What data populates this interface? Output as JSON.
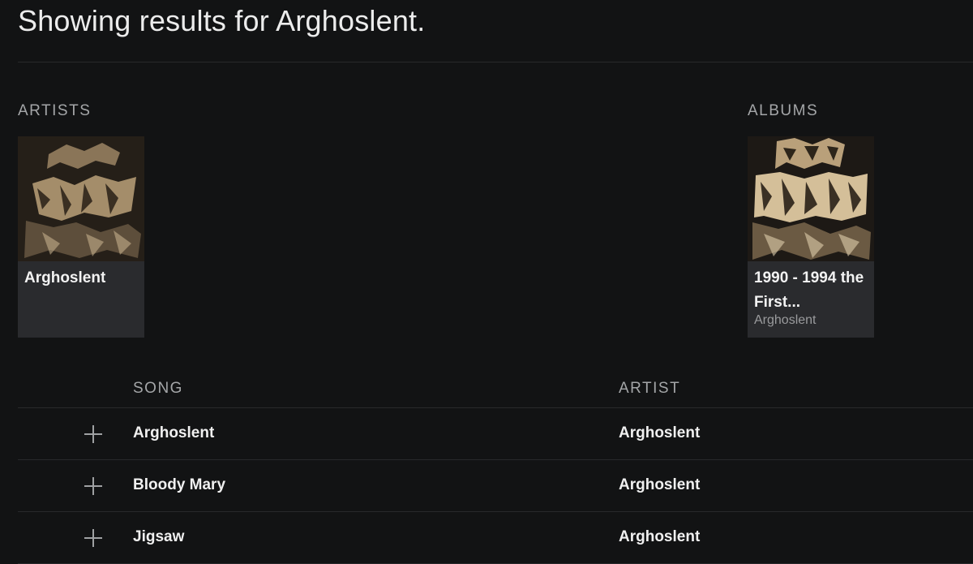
{
  "header": {
    "title": "Showing results for Arghoslent."
  },
  "artists": {
    "label": "ARTISTS",
    "items": [
      {
        "name": "Arghoslent"
      }
    ]
  },
  "albums": {
    "label": "ALBUMS",
    "items": [
      {
        "title": "1990 - 1994 the First...",
        "artist": "Arghoslent"
      }
    ]
  },
  "tracks": {
    "columns": {
      "song": "SONG",
      "artist": "ARTIST"
    },
    "rows": [
      {
        "song": "Arghoslent",
        "artist": "Arghoslent"
      },
      {
        "song": "Bloody Mary",
        "artist": "Arghoslent"
      },
      {
        "song": "Jigsaw",
        "artist": "Arghoslent"
      }
    ]
  },
  "icons": {
    "add": "plus-icon"
  },
  "colors": {
    "background": "#121314",
    "card_background": "#2a2b2e",
    "divider": "#28292b",
    "muted_text": "#a4a6a8"
  }
}
